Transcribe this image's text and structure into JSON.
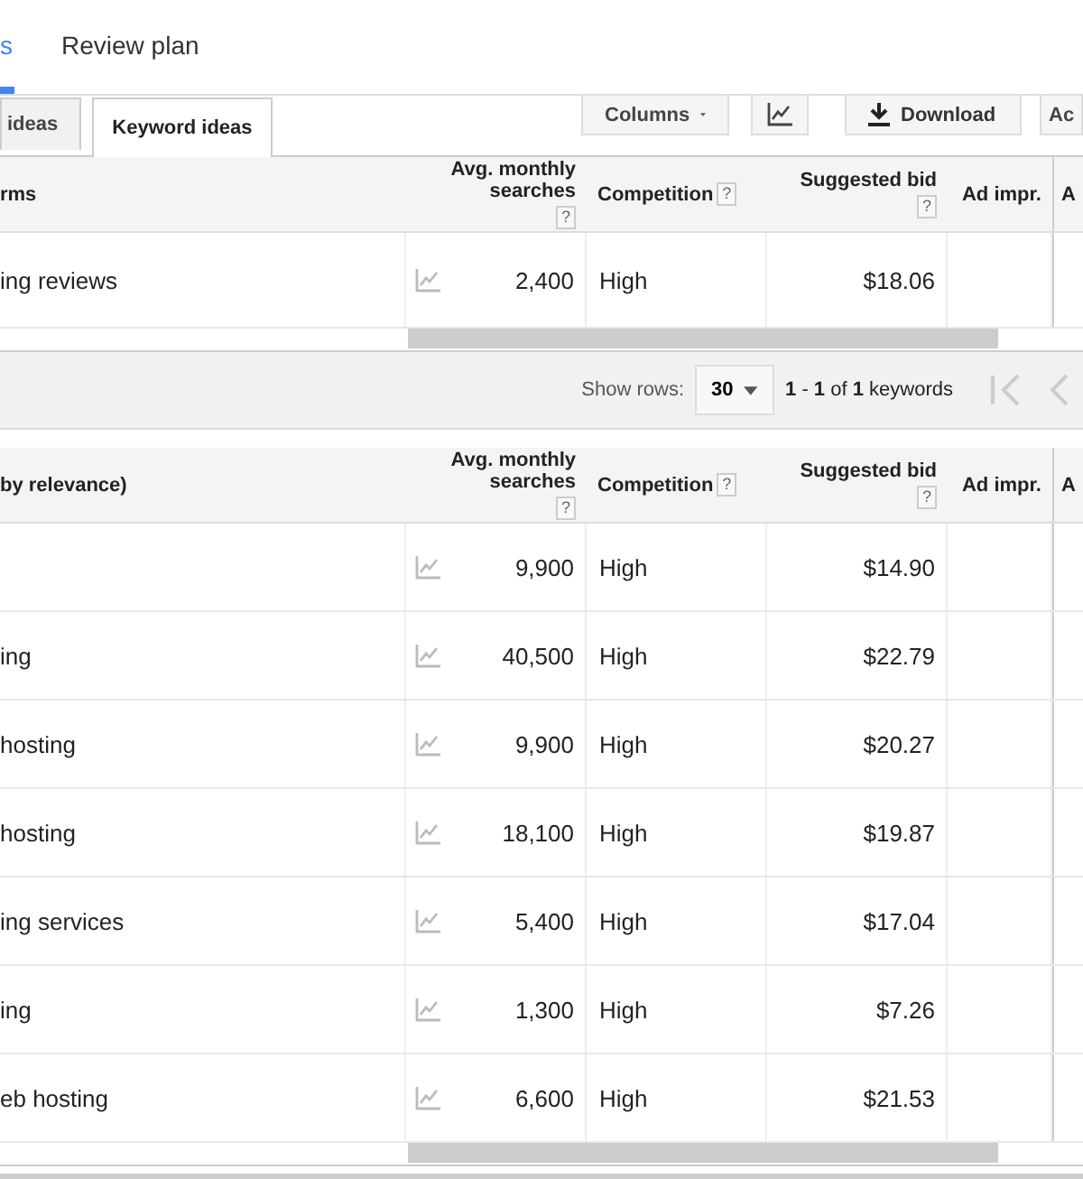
{
  "tabs": [
    {
      "label": "s",
      "selected": true
    },
    {
      "label": "Review plan",
      "selected": false
    }
  ],
  "subtabs": [
    {
      "label": "ideas",
      "selected": false
    },
    {
      "label": "Keyword ideas",
      "selected": true
    }
  ],
  "toolbar": {
    "columns": "Columns",
    "download": "Download",
    "more": "Ac"
  },
  "tables": [
    {
      "first_column": "rms",
      "columns": [
        {
          "label": "Avg. monthly searches",
          "help": "?"
        },
        {
          "label": "Competition",
          "help": "?"
        },
        {
          "label": "Suggested bid",
          "help": "?"
        },
        {
          "label": "Ad impr."
        },
        {
          "label": "A"
        }
      ],
      "rows": [
        {
          "keyword": "ing reviews",
          "searches": "2,400",
          "competition": "High",
          "bid": "$18.06"
        }
      ]
    },
    {
      "first_column": "by relevance)",
      "columns": [
        {
          "label": "Avg. monthly searches",
          "help": "?"
        },
        {
          "label": "Competition",
          "help": "?"
        },
        {
          "label": "Suggested bid",
          "help": "?"
        },
        {
          "label": "Ad impr."
        },
        {
          "label": "A"
        }
      ],
      "rows": [
        {
          "keyword": "",
          "searches": "9,900",
          "competition": "High",
          "bid": "$14.90"
        },
        {
          "keyword": "ing",
          "searches": "40,500",
          "competition": "High",
          "bid": "$22.79"
        },
        {
          "keyword": "hosting",
          "searches": "9,900",
          "competition": "High",
          "bid": "$20.27"
        },
        {
          "keyword": "hosting",
          "searches": "18,100",
          "competition": "High",
          "bid": "$19.87"
        },
        {
          "keyword": "ing services",
          "searches": "5,400",
          "competition": "High",
          "bid": "$17.04"
        },
        {
          "keyword": "ing",
          "searches": "1,300",
          "competition": "High",
          "bid": "$7.26"
        },
        {
          "keyword": "eb hosting",
          "searches": "6,600",
          "competition": "High",
          "bid": "$21.53"
        }
      ]
    }
  ],
  "pagination": {
    "label": "Show rows:",
    "value": "30",
    "range": "**1** - **1** of **1** keywords"
  }
}
